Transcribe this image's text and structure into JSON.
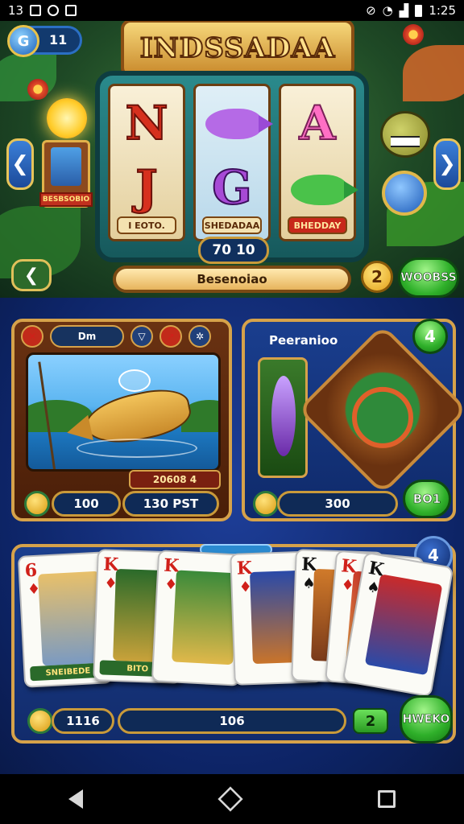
{
  "status_bar": {
    "left_text": "13",
    "time": "1:25"
  },
  "header": {
    "coin_badge_value": "11",
    "title": "INDSSADAA",
    "left_arrow": "❮",
    "right_arrow": "❯"
  },
  "slot": {
    "portrait_label": "BESBSOBIO",
    "reel1": {
      "top_symbol": "N",
      "bottom_symbol": "J",
      "tag": "I EOTO."
    },
    "reel2": {
      "bottom_symbol": "G",
      "tag": "SHEDADAA"
    },
    "reel3": {
      "top_symbol": "A",
      "tag": "BHEDDAY"
    },
    "amount": "70 10",
    "name_bar": "Besenoiao",
    "coin_number": "2",
    "green_button": "WOOBSS",
    "back_button": "❮"
  },
  "panel_fishing": {
    "tabs": [
      "Dm",
      "",
      "",
      ""
    ],
    "scene_tag": "20608 4",
    "left_value": "100",
    "right_value": "130 PST"
  },
  "panel_peraniao": {
    "title": "Peeranioo",
    "badge": "4",
    "value": "300",
    "button": "BO1"
  },
  "panel_cards": {
    "badge": "4",
    "cards": [
      {
        "rank": "6",
        "suit": "♦",
        "color": "red",
        "caption": "SNEIBEDE"
      },
      {
        "rank": "K",
        "suit": "♦",
        "color": "red",
        "caption": "BITO"
      },
      {
        "rank": "K",
        "suit": "♦",
        "color": "red",
        "caption": ""
      },
      {
        "rank": "K",
        "suit": "♦",
        "color": "red",
        "caption": ""
      },
      {
        "rank": "K",
        "suit": "♠",
        "color": "black",
        "caption": ""
      },
      {
        "rank": "K",
        "suit": "♦",
        "color": "red",
        "caption": ""
      },
      {
        "rank": "K",
        "suit": "♠",
        "color": "black",
        "caption": ""
      }
    ],
    "left_value": "1116",
    "mid_value": "106",
    "small_value": "2",
    "button": "HWEKO"
  }
}
